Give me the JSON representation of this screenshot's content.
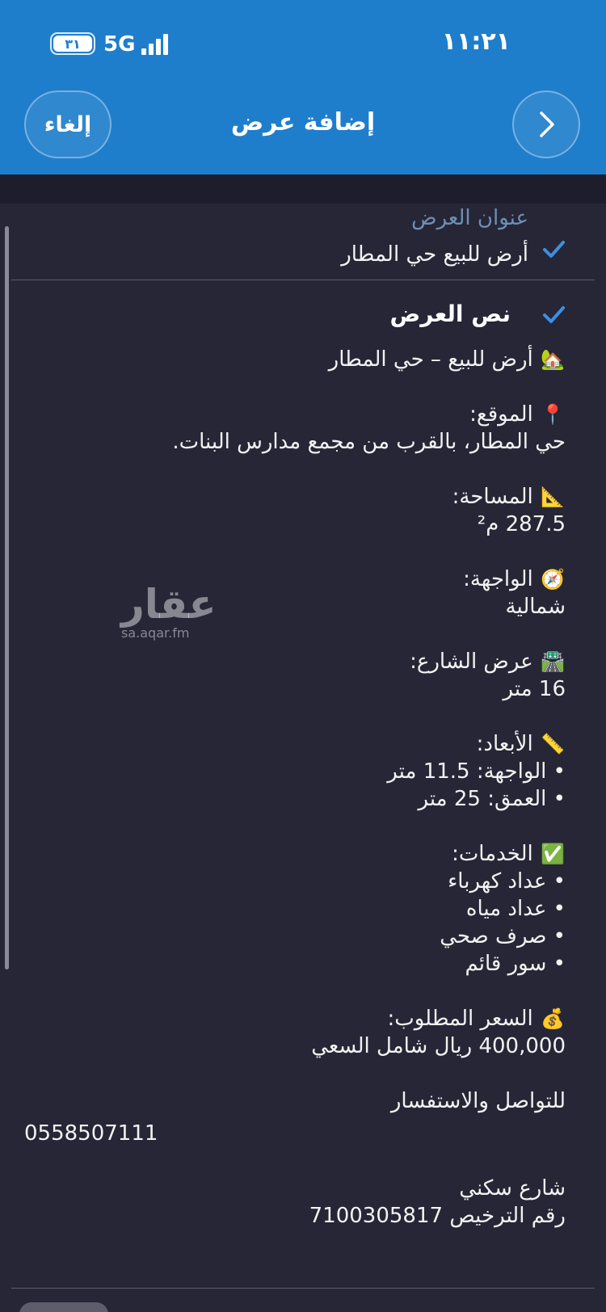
{
  "status_bar": {
    "time": "١١:٢١",
    "network": "5G",
    "battery": "٣١"
  },
  "nav": {
    "title": "إضافة عرض",
    "cancel_label": "إلغاء",
    "back_icon": "chevron-right-icon"
  },
  "offer": {
    "title_label": "عنوان العرض",
    "title_value": "أرض للبيع حي المطار",
    "body_label": "نص العرض"
  },
  "body": {
    "intro_emoji": "🏡",
    "intro": "أرض للبيع – حي المطار",
    "location_emoji": "📍",
    "location_label": "الموقع:",
    "location_value": "حي المطار، بالقرب من مجمع مدارس البنات.",
    "area_emoji": "📐",
    "area_label": "المساحة:",
    "area_value": "287.5 م²",
    "facing_emoji": "🧭",
    "facing_label": "الواجهة:",
    "facing_value": "شمالية",
    "street_emoji": "🛣️",
    "street_label": "عرض الشارع:",
    "street_value": "16 متر",
    "dims_emoji": "📏",
    "dims_label": "الأبعاد:",
    "dims_items": [
      "• الواجهة: 11.5 متر",
      "• العمق: 25 متر"
    ],
    "services_emoji": "✅",
    "services_label": "الخدمات:",
    "services_items": [
      "• عداد كهرباء",
      "• عداد مياه",
      "• صرف صحي",
      "• سور قائم"
    ],
    "price_emoji": "💰",
    "price_label": "السعر المطلوب:",
    "price_value": "400,000 ريال شامل السعي",
    "contact_label": "للتواصل والاستفسار",
    "phone": "0558507111",
    "street_name": "شارع سكني",
    "license": "رقم الترخيص 7100305817"
  },
  "watermark": {
    "logo": "عقار",
    "site": "sa.aqar.fm"
  },
  "colors": {
    "header": "#1f7ecb",
    "background": "#262637",
    "label": "#6e8fb4",
    "check": "#3d8fe0"
  }
}
